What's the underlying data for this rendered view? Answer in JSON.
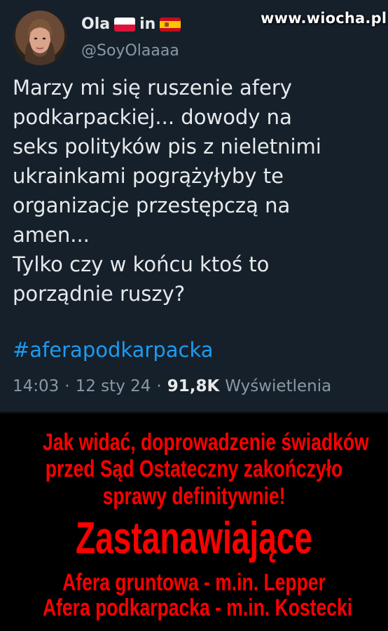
{
  "watermark": "www.wiocha.pl",
  "tweet": {
    "author_name": "Ola",
    "author_in": "in",
    "author_flags": [
      "flag-poland-icon",
      "flag-spain-icon"
    ],
    "handle": "@SoyOlaaaa",
    "text": "Marzy mi się ruszenie afery\npodkarpackiej... dowody na\nseks polityków pis z nieletnimi\nukrainkami pogrążyłyby te\norganizacje przestępczą na\namen...\nTylko czy w końcu ktoś to\nporządnie ruszy?",
    "hashtag": "#aferapodkarpacka",
    "time": "14:03",
    "date": "12 sty 24",
    "views_count": "91,8K",
    "views_label": "Wyświetlenia",
    "separator": "·"
  },
  "comment": {
    "line1": "Jak widać, doprowadzenie świadków",
    "line2": "przed Sąd Ostateczny zakończyło",
    "line3": "sprawy definitywnie!",
    "headline": "Zastanawiające",
    "line5": "Afera gruntowa - m.in. Lepper",
    "line6": "Afera podkarpacka - m.in. Kostecki"
  },
  "colors": {
    "tweet_background": "#15202b",
    "text": "#e7e9ea",
    "secondary_text": "#8b98a5",
    "hashtag": "#1d9bf0",
    "comment_text": "#ff0000",
    "comment_background": "#000000"
  }
}
